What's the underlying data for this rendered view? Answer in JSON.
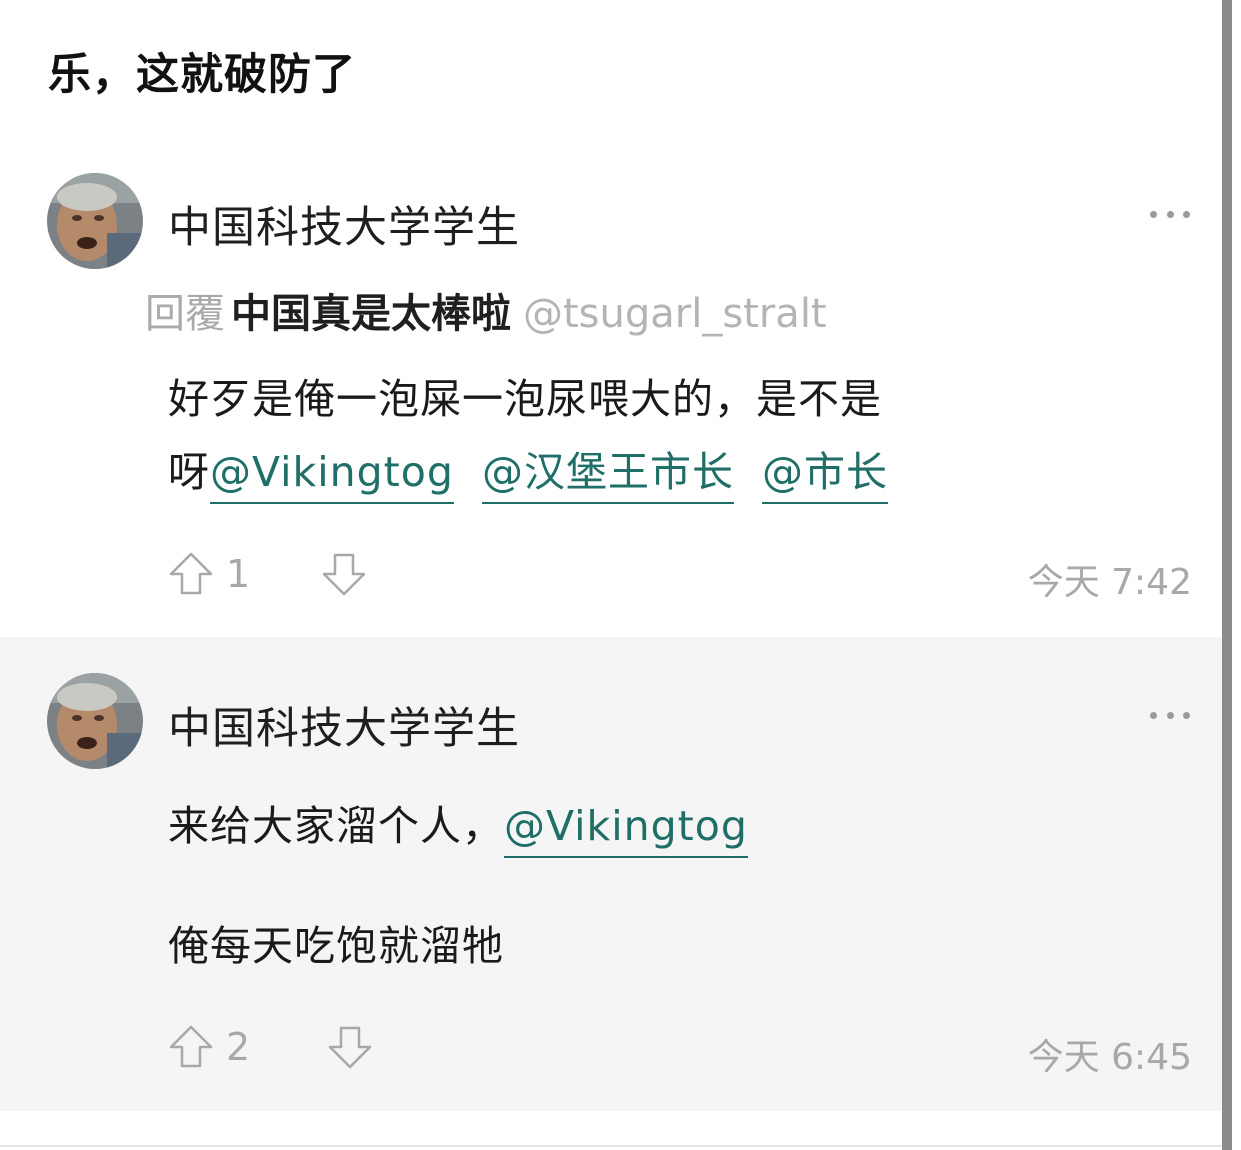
{
  "post": {
    "title": "乐，这就破防了"
  },
  "comments": [
    {
      "username": "中国科技大学学生",
      "avatar_icon": "avatar-photo-icon",
      "reply": {
        "label": "回覆",
        "name": "中国真是太棒啦",
        "handle": "@tsugarl_stralt"
      },
      "body_line1": "好歹是俺一泡屎一泡尿喂大的，是不是",
      "body_line2_prefix": "呀",
      "mentions": [
        "@Vikingtog",
        "@汉堡王市长",
        "@市长"
      ],
      "upvotes": "1",
      "time": "今天 7:42"
    },
    {
      "username": "中国科技大学学生",
      "avatar_icon": "avatar-photo-icon",
      "body_line1_prefix": "来给大家溜个人，",
      "mentions": [
        "@Vikingtog"
      ],
      "body_line2": "俺每天吃饱就溜牠",
      "upvotes": "2",
      "time": "今天 6:45"
    }
  ],
  "colors": {
    "mention": "#1f6e67",
    "muted": "#a8a8a8",
    "alt_background": "#f5f5f5"
  }
}
